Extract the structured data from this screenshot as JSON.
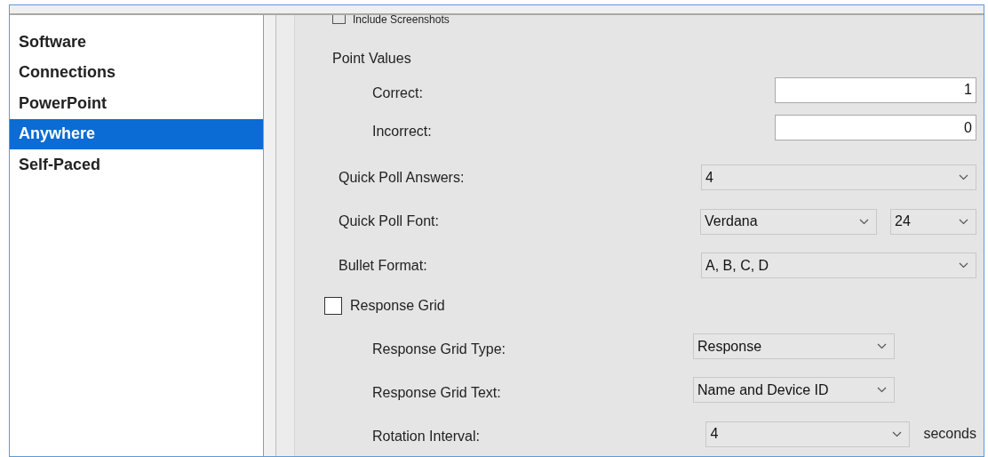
{
  "sidebar": {
    "items": [
      {
        "label": "Software",
        "selected": false
      },
      {
        "label": "Connections",
        "selected": false
      },
      {
        "label": "PowerPoint",
        "selected": false
      },
      {
        "label": "Anywhere",
        "selected": true
      },
      {
        "label": "Self-Paced",
        "selected": false
      }
    ]
  },
  "include_screenshots": {
    "label": "Include Screenshots",
    "checked": false
  },
  "point_values": {
    "heading": "Point Values",
    "fields": [
      {
        "label": "Correct:",
        "value": "1"
      },
      {
        "label": "Incorrect:",
        "value": "0"
      }
    ]
  },
  "settings": [
    {
      "label": "Quick Poll Answers:",
      "selects": [
        "4"
      ]
    },
    {
      "label": "Quick Poll Font:",
      "selects": [
        "Verdana",
        "24"
      ]
    },
    {
      "label": "Bullet Format:",
      "selects": [
        "A, B, C, D"
      ]
    }
  ],
  "response_grid": {
    "label": "Response Grid",
    "checked": false,
    "settings": [
      {
        "label": "Response Grid Type:",
        "selects": [
          "Response"
        ]
      },
      {
        "label": "Response Grid Text:",
        "selects": [
          "Name and Device ID"
        ]
      },
      {
        "label": "Rotation Interval:",
        "selects": [
          "4"
        ],
        "unit": "seconds"
      }
    ]
  }
}
